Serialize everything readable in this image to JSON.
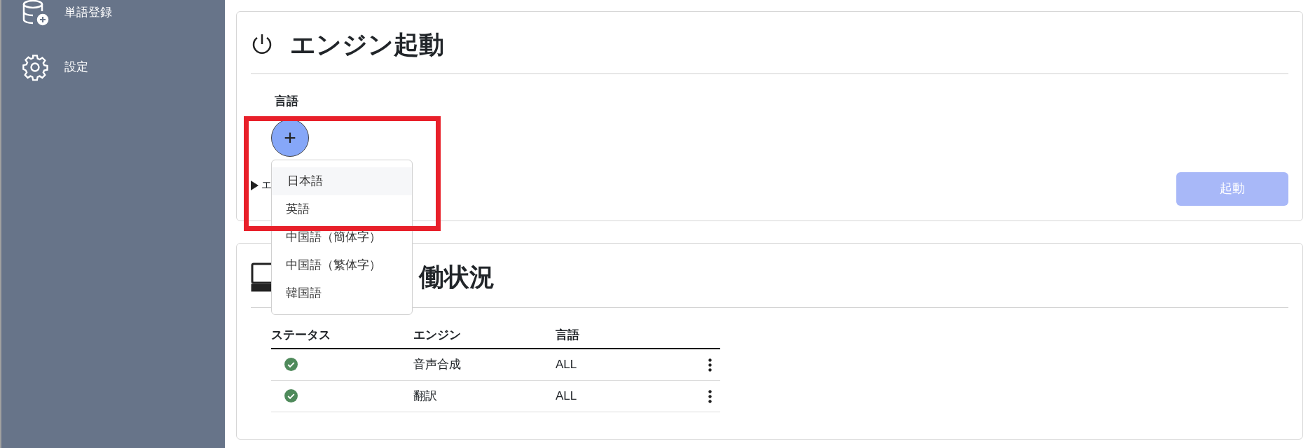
{
  "sidebar": {
    "items": [
      {
        "label": "単語登録"
      },
      {
        "label": "設定"
      }
    ]
  },
  "engine_start": {
    "title": "エンジン起動",
    "language_label": "言語",
    "add_button": "+",
    "details_label": "エ",
    "start_button": {
      "label": "起動",
      "disabled": true
    }
  },
  "language_menu": {
    "items": [
      {
        "label": "日本語",
        "selected": true
      },
      {
        "label": "英語",
        "selected": false
      },
      {
        "label": "中国語（簡体字）",
        "selected": false
      },
      {
        "label": "中国語（繁体字）",
        "selected": false
      },
      {
        "label": "韓国語",
        "selected": false
      }
    ]
  },
  "engine_status": {
    "title": "働状況",
    "columns": [
      "ステータス",
      "エンジン",
      "言語"
    ],
    "rows": [
      {
        "ok": true,
        "engine": "音声合成",
        "language": "ALL"
      },
      {
        "ok": true,
        "engine": "翻訳",
        "language": "ALL"
      }
    ]
  },
  "highlight": {
    "shown": true
  }
}
